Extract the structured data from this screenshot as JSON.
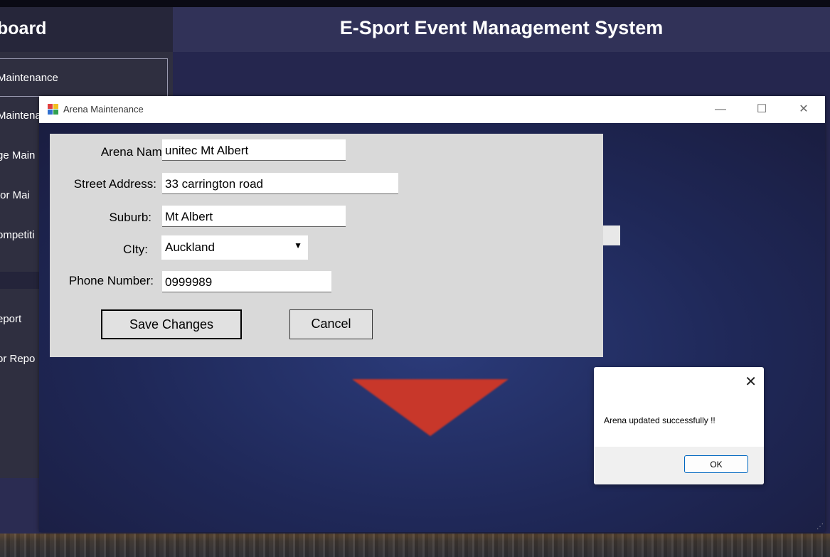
{
  "main": {
    "sidebar_title": "board",
    "app_title": "E-Sport Event Management System",
    "sidebar_items": [
      {
        "label": "Maintenance"
      },
      {
        "label": "Maintena"
      },
      {
        "label": "ge Main"
      },
      {
        "label": "tor Mai"
      },
      {
        "label": "ompetiti"
      },
      {
        "label": "eport"
      },
      {
        "label": "or Repo"
      }
    ]
  },
  "arena_window": {
    "title": "Arena Maintenance",
    "controls": {
      "minimize": "—",
      "maximize": "☐",
      "close": "✕"
    },
    "form": {
      "arena_name_label": "Arena Name:",
      "arena_name_value": "unitec Mt Albert",
      "street_label": "Street Address:",
      "street_value": "33 carrington road",
      "suburb_label": "Suburb:",
      "suburb_value": "Mt Albert",
      "city_label": "CIty:",
      "city_value": "Auckland",
      "phone_label": "Phone Number:",
      "phone_value": "0999989",
      "save_label": "Save Changes",
      "cancel_label": "Cancel"
    }
  },
  "message_box": {
    "text": "Arena updated successfully !!",
    "ok_label": "OK",
    "close": "✕"
  },
  "colors": {
    "sidebar": "#2f2f40",
    "header": "#313258",
    "form_panel": "#d9d9d9",
    "logo_red": "#c8372a"
  }
}
